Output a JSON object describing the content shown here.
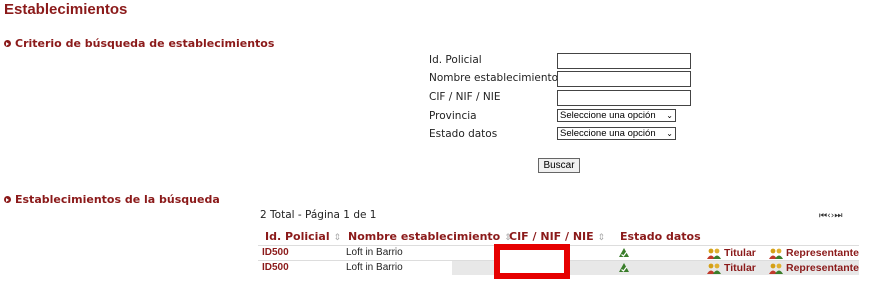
{
  "page": {
    "title": "Establecimientos"
  },
  "search": {
    "header": "Criterio de búsqueda de establecimientos",
    "fields": [
      {
        "label": "Id. Policial",
        "value": ""
      },
      {
        "label": "Nombre establecimiento",
        "value": ""
      },
      {
        "label": "CIF / NIF / NIE",
        "value": ""
      }
    ],
    "selects": [
      {
        "label": "Provincia",
        "value": "Seleccione una opción"
      },
      {
        "label": "Estado datos",
        "value": "Seleccione una opción"
      }
    ],
    "button_label": "Buscar"
  },
  "results": {
    "header": "Establecimientos de la búsqueda",
    "summary": "2 Total - Página 1 de 1",
    "pager": [
      "first",
      "prev",
      "next",
      "last"
    ],
    "pager_glyphs": {
      "first": "⏮",
      "prev": "‹",
      "next": "›",
      "last": "⏭"
    },
    "columns": [
      "Id. Policial",
      "Nombre establecimiento",
      "CIF / NIF / NIE",
      "Estado datos"
    ],
    "sort_glyph": "⇕",
    "rows": [
      {
        "id": "ID500",
        "name": "Loft in Barrio",
        "cif": "",
        "state_icon": "check-icon",
        "titular": "Titular",
        "representante": "Representante"
      },
      {
        "id": "ID500",
        "name": "Loft in Barrio",
        "cif": "",
        "state_icon": "check-icon",
        "titular": "Titular",
        "representante": "Representante"
      }
    ]
  },
  "colors": {
    "accent": "#8b1a1a",
    "redaction": "#e60000",
    "ok": "#3a7d2a"
  }
}
